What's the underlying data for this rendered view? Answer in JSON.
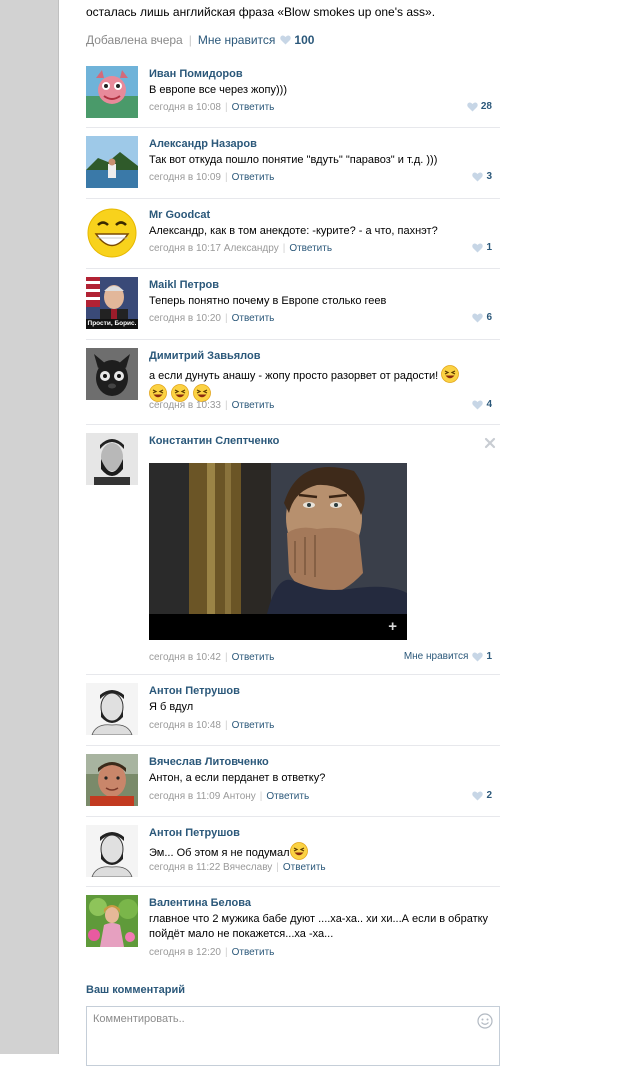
{
  "post": {
    "tail_text": "осталась лишь английская фраза «Blow smokes up one's ass».",
    "added": "Добавлена вчера",
    "like_label": "Мне нравится",
    "like_count": "100"
  },
  "comments": [
    {
      "author": "Иван Помидоров",
      "text": "В европе все через жопу)))",
      "time": "сегодня в 10:08",
      "reply_to": "",
      "reply_label": "Ответить",
      "likes": "28"
    },
    {
      "author": "Александр Назаров",
      "text": "Так вот откуда пошло понятие \"вдуть\" \"паравоз\" и т.д. )))",
      "time": "сегодня в 10:09",
      "reply_to": "",
      "reply_label": "Ответить",
      "likes": "3"
    },
    {
      "author": "Mr Goodcat",
      "text": "Александр, как в том анекдоте: -курите? - а что, пахнэт?",
      "time": "сегодня в 10:17",
      "reply_to": "Александру",
      "reply_label": "Ответить",
      "likes": "1"
    },
    {
      "author": "Maikl Петров",
      "text": "Теперь понятно почему в Европе столько геев",
      "time": "сегодня в 10:20",
      "reply_to": "",
      "reply_label": "Ответить",
      "likes": "6",
      "avatar_caption": "Прости, Борис."
    },
    {
      "author": "Димитрий Завьялов",
      "text": "а если дунуть анашу - жопу просто разорвет от радости!",
      "time": "сегодня в 10:33",
      "reply_to": "",
      "reply_label": "Ответить",
      "likes": "4"
    },
    {
      "author": "Константин Слептченко",
      "text": "",
      "time": "сегодня в 10:42",
      "reply_to": "",
      "reply_label": "Ответить",
      "likes": "1",
      "like_label": "Мне нравится",
      "photo_plus": "+"
    },
    {
      "author": "Антон Петрушов",
      "text": "Я б вдул",
      "time": "сегодня в 10:48",
      "reply_to": "",
      "reply_label": "Ответить",
      "likes": ""
    },
    {
      "author": "Вячеслав Литовченко",
      "text": "Антон, а если перданет в ответку?",
      "time": "сегодня в 11:09",
      "reply_to": "Антону",
      "reply_label": "Ответить",
      "likes": "2"
    },
    {
      "author": "Антон Петрушов",
      "text": "Эм... Об этом я не подумал",
      "time": "сегодня в 11:22",
      "reply_to": "Вячеславу",
      "reply_label": "Ответить",
      "likes": ""
    },
    {
      "author": "Валентина Белова",
      "text": "главное что 2 мужика бабе дуют ....ха-ха.. хи хи...А если в обратку пойдёт мало не покажется...ха -ха...",
      "time": "сегодня в 12:20",
      "reply_to": "",
      "reply_label": "Ответить",
      "likes": ""
    }
  ],
  "compose": {
    "title": "Ваш комментарий",
    "placeholder": "Комментировать.."
  },
  "colors": {
    "link": "#2b587a",
    "meta": "#999999",
    "divider": "#e7e8ec",
    "heart": "#c7d6e6"
  }
}
